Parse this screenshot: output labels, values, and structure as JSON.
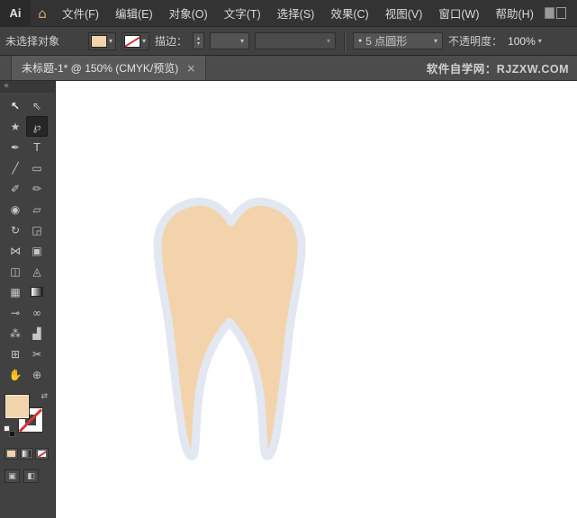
{
  "app": {
    "logo_text": "Ai"
  },
  "icons": {
    "home": "⌂",
    "caret_down": "▾",
    "spin_up": "▴",
    "spin_down": "▾",
    "collapse_left": "«",
    "swap": "⇄",
    "close": "×",
    "draw_mode": "▣",
    "screen_mode": "◧"
  },
  "menu_bar": {
    "items": [
      "文件(F)",
      "编辑(E)",
      "对象(O)",
      "文字(T)",
      "选择(S)",
      "效果(C)",
      "视图(V)",
      "窗口(W)",
      "帮助(H)"
    ]
  },
  "control_bar": {
    "selection_status": "未选择对象",
    "stroke_label": "描边：",
    "stroke_weight_value": "",
    "brush_bullet": "●",
    "brush_value": "5 点圆形",
    "opacity_label": "不透明度：",
    "opacity_value": "100%"
  },
  "tab_bar": {
    "tab_title": "未标题-1* @ 150% (CMYK/预览)",
    "site_label": "软件自学网：RJZXW.COM"
  },
  "swatches": {
    "fill_color": "#F2D3AC"
  },
  "toolbar": {
    "tools": [
      {
        "name": "selection",
        "glyph": "↖",
        "selected": false
      },
      {
        "name": "direct-selection",
        "glyph": "⇖",
        "selected": false
      },
      {
        "name": "magic-wand",
        "glyph": "★",
        "selected": false
      },
      {
        "name": "lasso",
        "glyph": "℘",
        "selected": true
      },
      {
        "name": "pen",
        "glyph": "✒",
        "selected": false
      },
      {
        "name": "type",
        "glyph": "T",
        "selected": false
      },
      {
        "name": "line-segment",
        "glyph": "╱",
        "selected": false
      },
      {
        "name": "rectangle",
        "glyph": "▭",
        "selected": false
      },
      {
        "name": "paintbrush",
        "glyph": "✐",
        "selected": false
      },
      {
        "name": "pencil",
        "glyph": "✏",
        "selected": false
      },
      {
        "name": "blob-brush",
        "glyph": "◉",
        "selected": false
      },
      {
        "name": "eraser",
        "glyph": "▱",
        "selected": false
      },
      {
        "name": "rotate",
        "glyph": "↻",
        "selected": false
      },
      {
        "name": "scale",
        "glyph": "◲",
        "selected": false
      },
      {
        "name": "width",
        "glyph": "⋈",
        "selected": false
      },
      {
        "name": "free-transform",
        "glyph": "▣",
        "selected": false
      },
      {
        "name": "shape-builder",
        "glyph": "◫",
        "selected": false
      },
      {
        "name": "perspective-grid",
        "glyph": "◬",
        "selected": false
      },
      {
        "name": "mesh",
        "glyph": "▦",
        "selected": false
      },
      {
        "name": "gradient",
        "glyph": "",
        "selected": false
      },
      {
        "name": "eyedropper",
        "glyph": "⊸",
        "selected": false
      },
      {
        "name": "blend",
        "glyph": "∞",
        "selected": false
      },
      {
        "name": "symbol-sprayer",
        "glyph": "⁂",
        "selected": false
      },
      {
        "name": "column-graph",
        "glyph": "▟",
        "selected": false
      },
      {
        "name": "artboard",
        "glyph": "⊞",
        "selected": false
      },
      {
        "name": "slice",
        "glyph": "✂",
        "selected": false
      },
      {
        "name": "hand",
        "glyph": "✋",
        "selected": false
      },
      {
        "name": "zoom",
        "glyph": "⊕",
        "selected": false
      }
    ]
  },
  "canvas": {
    "artboard_color": "#FFFFFF",
    "tooth": {
      "fill": "#F2D3AC",
      "outline": "#E2E7F1",
      "outline_width": 9
    }
  }
}
